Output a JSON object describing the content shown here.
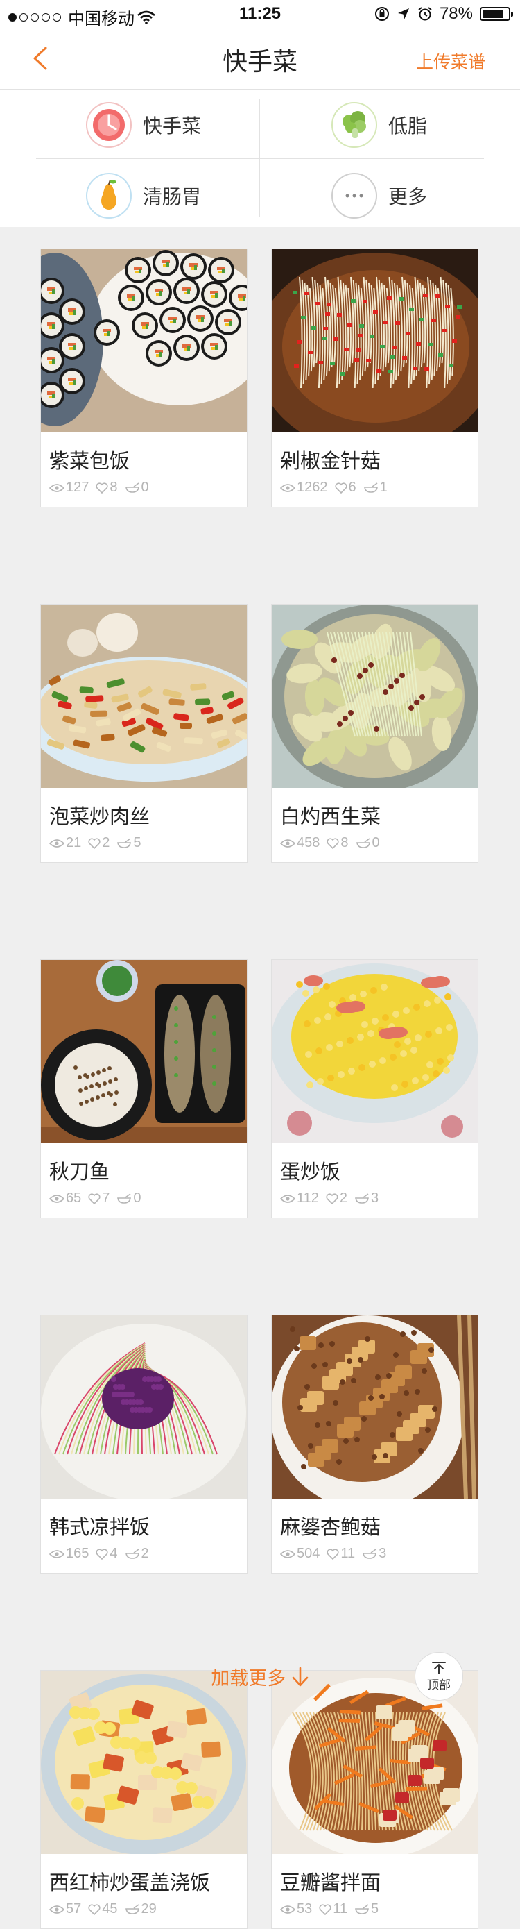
{
  "status_bar": {
    "carrier": "中国移动",
    "time": "11:25",
    "battery": "78%"
  },
  "nav": {
    "title": "快手菜",
    "upload": "上传菜谱"
  },
  "categories": [
    {
      "label": "快手菜",
      "icon": "clock-icon"
    },
    {
      "label": "低脂",
      "icon": "broccoli-icon"
    },
    {
      "label": "清肠胃",
      "icon": "pear-icon"
    },
    {
      "label": "更多",
      "icon": "more-icon"
    }
  ],
  "recipes": [
    {
      "name": "紫菜包饭",
      "views": "127",
      "likes": "8",
      "comments": "0",
      "photo": "kimbap"
    },
    {
      "name": "剁椒金针菇",
      "views": "1262",
      "likes": "6",
      "comments": "1",
      "photo": "enoki-chili"
    },
    {
      "name": "泡菜炒肉丝",
      "views": "21",
      "likes": "2",
      "comments": "5",
      "photo": "stir-fry-pork"
    },
    {
      "name": "白灼西生菜",
      "views": "458",
      "likes": "8",
      "comments": "0",
      "photo": "blanched-lettuce"
    },
    {
      "name": "秋刀鱼",
      "views": "65",
      "likes": "7",
      "comments": "0",
      "photo": "saury-rice"
    },
    {
      "name": "蛋炒饭",
      "views": "112",
      "likes": "2",
      "comments": "3",
      "photo": "egg-fried-rice"
    },
    {
      "name": "韩式凉拌饭",
      "views": "165",
      "likes": "4",
      "comments": "2",
      "photo": "korean-noodles"
    },
    {
      "name": "麻婆杏鲍菇",
      "views": "504",
      "likes": "11",
      "comments": "3",
      "photo": "mapo-mushroom"
    },
    {
      "name": "西红柿炒蛋盖浇饭",
      "views": "57",
      "likes": "45",
      "comments": "29",
      "photo": "tomato-egg-rice"
    },
    {
      "name": "豆瓣酱拌面",
      "views": "53",
      "likes": "11",
      "comments": "5",
      "photo": "bean-paste-noodles"
    }
  ],
  "footer": {
    "load_more": "加载更多",
    "top_label": "顶部"
  },
  "colors": {
    "accent": "#f07a2a",
    "background": "#efefef"
  }
}
